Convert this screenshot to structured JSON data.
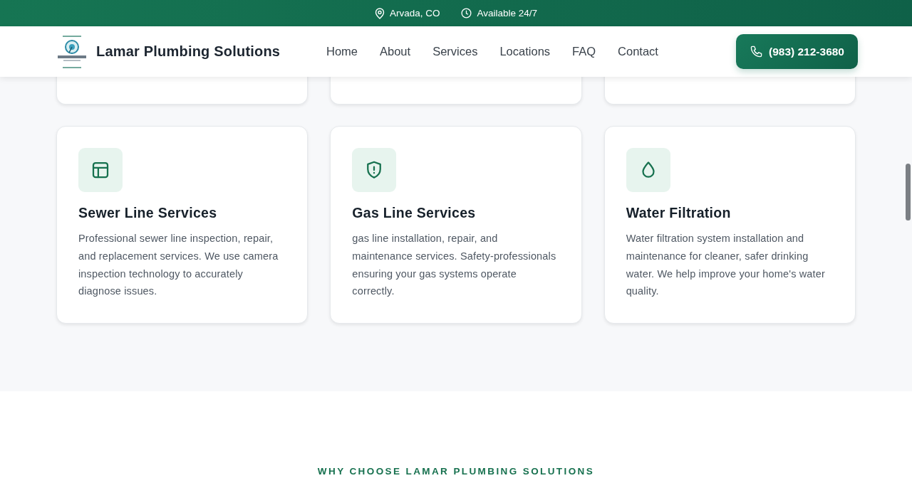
{
  "top_bar": {
    "location": "Arvada, CO",
    "availability": "Available 24/7"
  },
  "header": {
    "brand": "Lamar Plumbing Solutions",
    "nav": [
      {
        "label": "Home"
      },
      {
        "label": "About"
      },
      {
        "label": "Services"
      },
      {
        "label": "Locations"
      },
      {
        "label": "FAQ"
      },
      {
        "label": "Contact"
      }
    ],
    "phone_button": "(983) 212-3680"
  },
  "services": [
    {
      "kind": "layout",
      "title": "Sewer Line Services",
      "description": "Professional sewer line inspection, repair, and replacement services. We use camera inspection technology to accurately diagnose issues."
    },
    {
      "kind": "shield",
      "title": "Gas Line Services",
      "description": "gas line installation, repair, and maintenance services. Safety-professionals ensuring your gas systems operate correctly."
    },
    {
      "kind": "drop",
      "title": "Water Filtration",
      "description": "Water filtration system installation and maintenance for cleaner, safer drinking water. We help improve your home's water quality."
    }
  ],
  "why_section": {
    "eyebrow": "WHY CHOOSE LAMAR PLUMBING SOLUTIONS"
  }
}
